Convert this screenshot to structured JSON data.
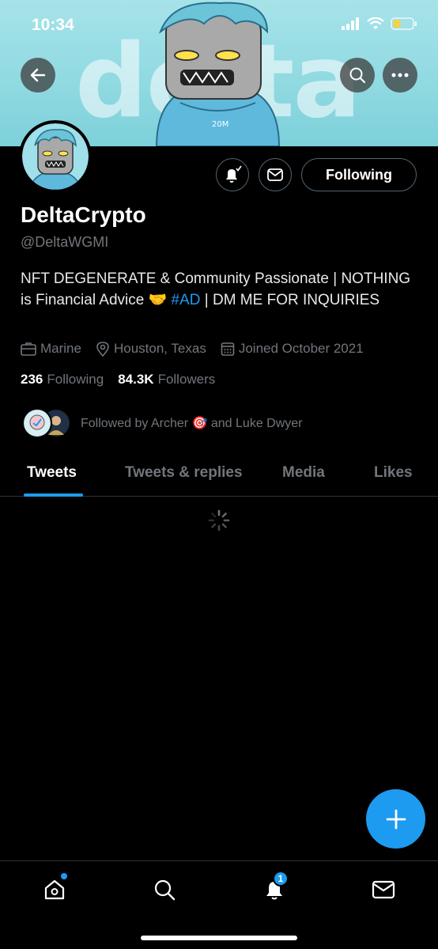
{
  "status_bar": {
    "time": "10:34"
  },
  "banner": {
    "word": "delta"
  },
  "profile": {
    "display_name": "DeltaCrypto",
    "handle": "@DeltaWGMI",
    "bio_part1": "NFT DEGENERATE & Community Passionate | NOTHING is Financial Advice 🤝 ",
    "bio_hashtag": "#AD",
    "bio_part2": " | DM ME FOR INQUIRIES",
    "profession": "Marine",
    "location": "Houston, Texas",
    "joined": "Joined October 2021",
    "following_count": "236",
    "following_label": "Following",
    "followers_count": "84.3K",
    "followers_label": "Followers",
    "followed_by": "Followed by Archer 🎯 and Luke Dwyer"
  },
  "actions": {
    "following_button": "Following"
  },
  "tabs": [
    {
      "label": "Tweets",
      "active": true
    },
    {
      "label": "Tweets & replies",
      "active": false
    },
    {
      "label": "Media",
      "active": false
    },
    {
      "label": "Likes",
      "active": false
    }
  ],
  "nav": {
    "notifications_badge": "1"
  },
  "colors": {
    "accent": "#1d9bf0",
    "background": "#000000",
    "banner": "#8fd9e1"
  }
}
